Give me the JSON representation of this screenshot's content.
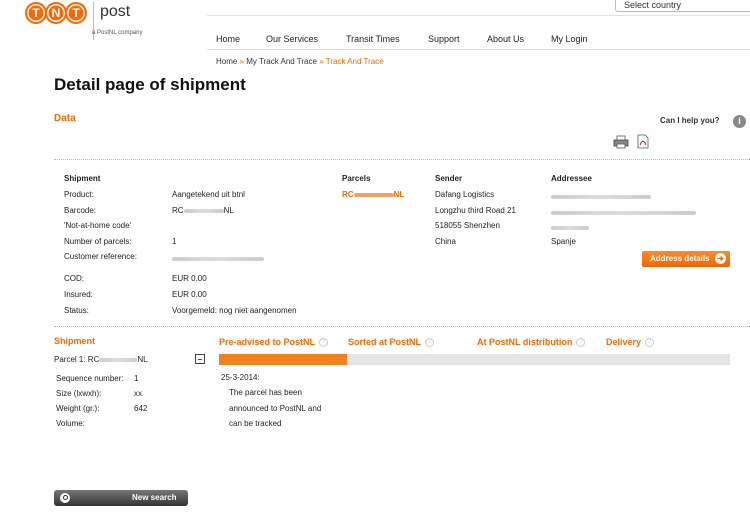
{
  "logo": {
    "text": "post",
    "subtext": "a PostNL company",
    "letters": [
      "T",
      "N",
      "T"
    ],
    "brand_color": "#ff6600"
  },
  "country_select": {
    "value": "Select country"
  },
  "nav": [
    "Home",
    "Our Services",
    "Transit Times",
    "Support",
    "About Us",
    "My Login"
  ],
  "breadcrumb": {
    "items": [
      "Home",
      "My Track And Trace"
    ],
    "current": "Track And Trace",
    "separator": "»"
  },
  "page_title": "Detail page of shipment",
  "data_heading": "Data",
  "help_text": "Can I help you?",
  "icons": {
    "print": "print-icon",
    "pdf": "pdf-icon",
    "info": "info-icon"
  },
  "shipment": {
    "heading": "Shipment",
    "labels": [
      "Product:",
      "Barcode:",
      "'Not-at-home code'",
      "Number of parcels:",
      "Customer reference:"
    ],
    "values": [
      "Aangetekend uit btnl",
      "RC",
      "",
      "1",
      ""
    ],
    "barcode_suffix": "NL",
    "cod_labels": [
      "COD:",
      "Insured:",
      "Status:"
    ],
    "cod_values": [
      "EUR 0.00",
      "EUR 0.00",
      "Voorgemeld: nog niet aangenomen"
    ]
  },
  "parcels": {
    "heading": "Parcels",
    "prefix": "RC",
    "suffix": "NL"
  },
  "sender": {
    "heading": "Sender",
    "lines": [
      "Dafang Logistics",
      "Longzhu third Road 21",
      "518055 Shenzhen",
      "China"
    ]
  },
  "addressee": {
    "heading": "Addressee",
    "country": "Spanje",
    "button": "Address details"
  },
  "tracking": {
    "heading": "Shipment",
    "parcel_label": "Parcel 1: RC",
    "parcel_suffix": "NL",
    "details": [
      {
        "label": "Sequence number:",
        "value": "1"
      },
      {
        "label": "Size (lxwxh):",
        "value": "xx"
      },
      {
        "label": "Weight (gr.):",
        "value": "642"
      },
      {
        "label": "Volume:",
        "value": ""
      }
    ],
    "stages": [
      "Pre-advised to PostNL",
      "Sorted at PostNL",
      "At PostNL distribution",
      "Delivery"
    ],
    "progress_fraction": 0.25,
    "status_date": "25-3-2014:",
    "status_lines": [
      "The parcel has been",
      "announced to PostNL and",
      "can be tracked"
    ]
  },
  "new_search": "New search"
}
